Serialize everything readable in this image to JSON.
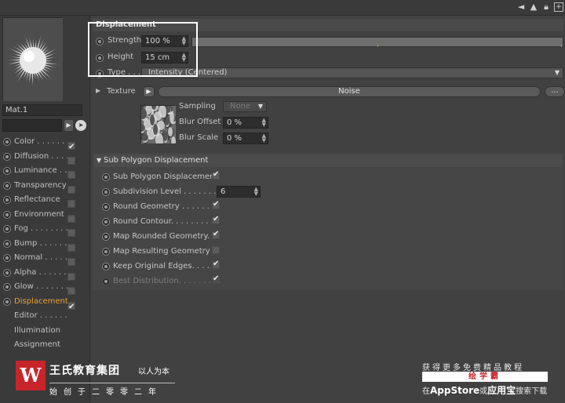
{
  "left": {
    "material_name": "Mat.1",
    "channels": [
      {
        "label": "Color",
        "dots": ". . . . . . .",
        "checked": true
      },
      {
        "label": "Diffusion",
        "dots": ". . . .",
        "checked": false
      },
      {
        "label": "Luminance",
        "dots": ". . .",
        "checked": false
      },
      {
        "label": "Transparency",
        "dots": "",
        "checked": false
      },
      {
        "label": "Reflectance",
        "dots": "",
        "checked": false
      },
      {
        "label": "Environment",
        "dots": "",
        "checked": false
      },
      {
        "label": "Fog",
        "dots": ". . . . . . . .",
        "checked": false
      },
      {
        "label": "Bump",
        "dots": ". . . . . . .",
        "checked": false
      },
      {
        "label": "Normal",
        "dots": ". . . . . .",
        "checked": false
      },
      {
        "label": "Alpha",
        "dots": ". . . . . . .",
        "checked": false
      },
      {
        "label": "Glow",
        "dots": ". . . . . . . .",
        "checked": false
      },
      {
        "label": "Displacement",
        "dots": "",
        "checked": true,
        "active": true
      },
      {
        "label": "Editor",
        "dots": ". . . . . . .",
        "checked": null
      },
      {
        "label": "Illumination",
        "dots": "",
        "checked": null
      },
      {
        "label": "Assignment",
        "dots": "",
        "checked": null
      }
    ]
  },
  "displacement": {
    "title": "Displacement",
    "strength_label": "Strength",
    "strength_value": "100 %",
    "strength_fraction": 1.0,
    "height_label": "Height",
    "height_value": "15 cm",
    "type_label": "Type . . .",
    "type_value": "Intensity (Centered)",
    "texture_label": "Texture",
    "texture_name": "Noise",
    "texture_more": "...",
    "sampling_label": "Sampling",
    "sampling_value": "None",
    "blur_offset_label": "Blur Offset",
    "blur_offset_value": "0 %",
    "blur_scale_label": "Blur Scale",
    "blur_scale_value": "0 %"
  },
  "subpoly": {
    "title": "Sub Polygon Displacement",
    "rows": [
      {
        "label": "Sub Polygon Displacement",
        "checked": true,
        "dim": false
      },
      {
        "label": "Subdivision Level . . . . . . . .",
        "value": "6",
        "dim": false
      },
      {
        "label": "Round Geometry . . . . . . . .",
        "checked": true,
        "dim": false
      },
      {
        "label": "Round Contour. . . . . . . . . .",
        "checked": true,
        "dim": false
      },
      {
        "label": "Map Rounded Geometry. .",
        "checked": true,
        "dim": false
      },
      {
        "label": "Map Resulting Geometry .",
        "checked": false,
        "dim": false
      },
      {
        "label": "Keep Original Edges. . . . . .",
        "checked": true,
        "dim": false
      },
      {
        "label": "Best Distribution. . . . . . . . .",
        "checked": true,
        "dim": true
      }
    ]
  },
  "branding": {
    "logo_letter": "W",
    "name": "王氏教育集团",
    "slogan": "以人为本",
    "since": "始创于二零零二年"
  },
  "promo": {
    "line1": "获得更多免费精品教程",
    "app_name": "绘学霸",
    "line2_prefix": "在",
    "store1": "AppStore",
    "line2_mid": "或",
    "store2": "应用宝",
    "line2_suffix": "搜索下载"
  },
  "colors": {
    "active_channel": "#f0a030",
    "brand_red": "#c8252b",
    "highlight": "#ffffff"
  }
}
